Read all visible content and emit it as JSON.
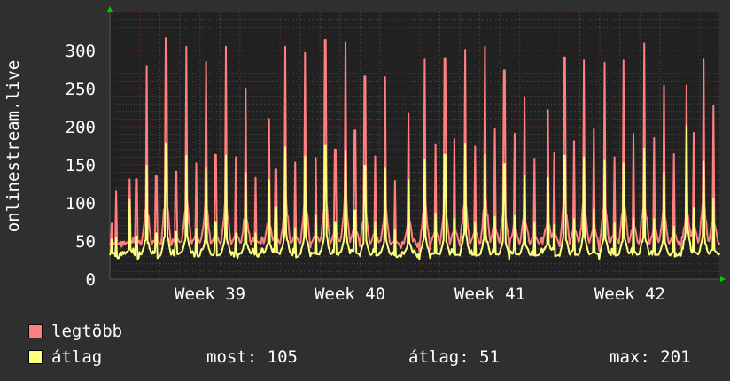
{
  "chart_data": {
    "type": "line",
    "ylabel": "onlinestream.live",
    "ylim": [
      0,
      350
    ],
    "yticks": [
      "0",
      "50",
      "100",
      "150",
      "200",
      "250",
      "300"
    ],
    "ytick_values": [
      0,
      50,
      100,
      150,
      200,
      250,
      300
    ],
    "x_unit": "days since start of Week 39",
    "xlim": [
      -1.51,
      28.98
    ],
    "xticks": [
      {
        "label": "Week 39",
        "start": 0
      },
      {
        "label": "Week 40",
        "start": 7
      },
      {
        "label": "Week 41",
        "start": 14
      },
      {
        "label": "Week 42",
        "start": 21
      }
    ],
    "grid": true,
    "series": [
      {
        "name": "legtöbb",
        "color": "#ff7f7f",
        "baseline": 45
      },
      {
        "name": "átlag",
        "color": "#ffff7f",
        "baseline": 32
      }
    ],
    "spikes_day_max_avg": [
      [
        -1.43,
        73,
        52
      ],
      [
        -1.18,
        116,
        54
      ],
      [
        -0.53,
        131,
        104
      ],
      [
        -0.18,
        131,
        56
      ],
      [
        0.32,
        280,
        149
      ],
      [
        0.81,
        135,
        60
      ],
      [
        1.3,
        316,
        178
      ],
      [
        1.8,
        141,
        62
      ],
      [
        2.32,
        305,
        162
      ],
      [
        2.8,
        152,
        66
      ],
      [
        3.29,
        285,
        145
      ],
      [
        3.78,
        163,
        75
      ],
      [
        4.3,
        305,
        162
      ],
      [
        4.8,
        160,
        60
      ],
      [
        5.29,
        250,
        139
      ],
      [
        5.77,
        133,
        60
      ],
      [
        6.44,
        210,
        130
      ],
      [
        6.79,
        144,
        94
      ],
      [
        7.28,
        305,
        173
      ],
      [
        7.77,
        153,
        67
      ],
      [
        8.27,
        297,
        161
      ],
      [
        8.79,
        159,
        83
      ],
      [
        9.27,
        314,
        175
      ],
      [
        9.76,
        170,
        75
      ],
      [
        10.27,
        311,
        169
      ],
      [
        10.75,
        195,
        90
      ],
      [
        11.25,
        266,
        149
      ],
      [
        11.75,
        161,
        75
      ],
      [
        12.26,
        265,
        145
      ],
      [
        12.76,
        129,
        64
      ],
      [
        13.44,
        218,
        130
      ],
      [
        14.24,
        288,
        156
      ],
      [
        14.77,
        177,
        86
      ],
      [
        15.25,
        290,
        163
      ],
      [
        15.74,
        184,
        79
      ],
      [
        16.25,
        301,
        178
      ],
      [
        16.76,
        174,
        75
      ],
      [
        17.27,
        305,
        163
      ],
      [
        17.74,
        197,
        82
      ],
      [
        18.22,
        274,
        151
      ],
      [
        18.73,
        191,
        83
      ],
      [
        19.24,
        239,
        136
      ],
      [
        19.73,
        158,
        75
      ],
      [
        20.39,
        222,
        133
      ],
      [
        20.72,
        166,
        71
      ],
      [
        21.24,
        291,
        162
      ],
      [
        21.72,
        181,
        79
      ],
      [
        22.21,
        287,
        160
      ],
      [
        22.7,
        197,
        92
      ],
      [
        23.23,
        284,
        155
      ],
      [
        23.72,
        160,
        74
      ],
      [
        24.2,
        287,
        152
      ],
      [
        24.69,
        191,
        80
      ],
      [
        25.22,
        310,
        171
      ],
      [
        25.73,
        185,
        79
      ],
      [
        26.2,
        254,
        140
      ],
      [
        26.7,
        164,
        69
      ],
      [
        27.35,
        254,
        201
      ],
      [
        27.7,
        192,
        93
      ],
      [
        28.19,
        288,
        154
      ],
      [
        28.68,
        227,
        105
      ]
    ]
  },
  "legend": {
    "items": [
      {
        "label": "legtöbb",
        "color": "#ff7f7f"
      },
      {
        "label": "átlag",
        "color": "#ffff7f"
      }
    ],
    "stats": {
      "most": "most: 105",
      "atlag": "átlag: 51",
      "max": "max: 201"
    }
  }
}
